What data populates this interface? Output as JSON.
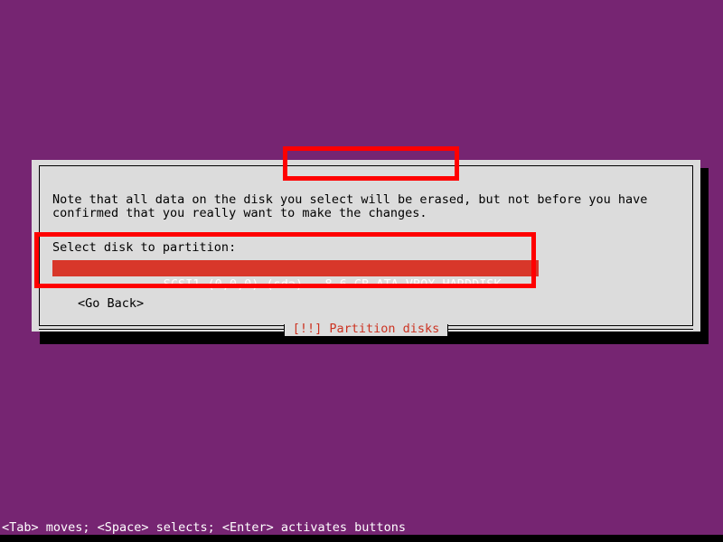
{
  "screen": {
    "background_color": "#762572",
    "text_color": "#ffffff"
  },
  "dialog": {
    "title": "[!!] Partition disks",
    "title_color": "#cc3322",
    "background_color": "#dcdcdc",
    "body_text": "Note that all data on the disk you select will be erased, but not before you have confirmed that you really want to make the changes.",
    "select_label": "Select disk to partition:",
    "disk_options": [
      {
        "label": "SCSI1 (0,0,0) (sda) - 8.6 GB ATA VBOX HARDDISK",
        "selected": true,
        "highlight_color": "#d8372a",
        "highlight_text_color": "#ffffff"
      }
    ],
    "go_back_label": "<Go Back>"
  },
  "footer": {
    "hint": "<Tab> moves; <Space> selects; <Enter> activates buttons"
  },
  "annotations": {
    "color": "#ff0000",
    "boxes": [
      {
        "target": "dialog-title"
      },
      {
        "target": "select-disk-group"
      }
    ]
  }
}
